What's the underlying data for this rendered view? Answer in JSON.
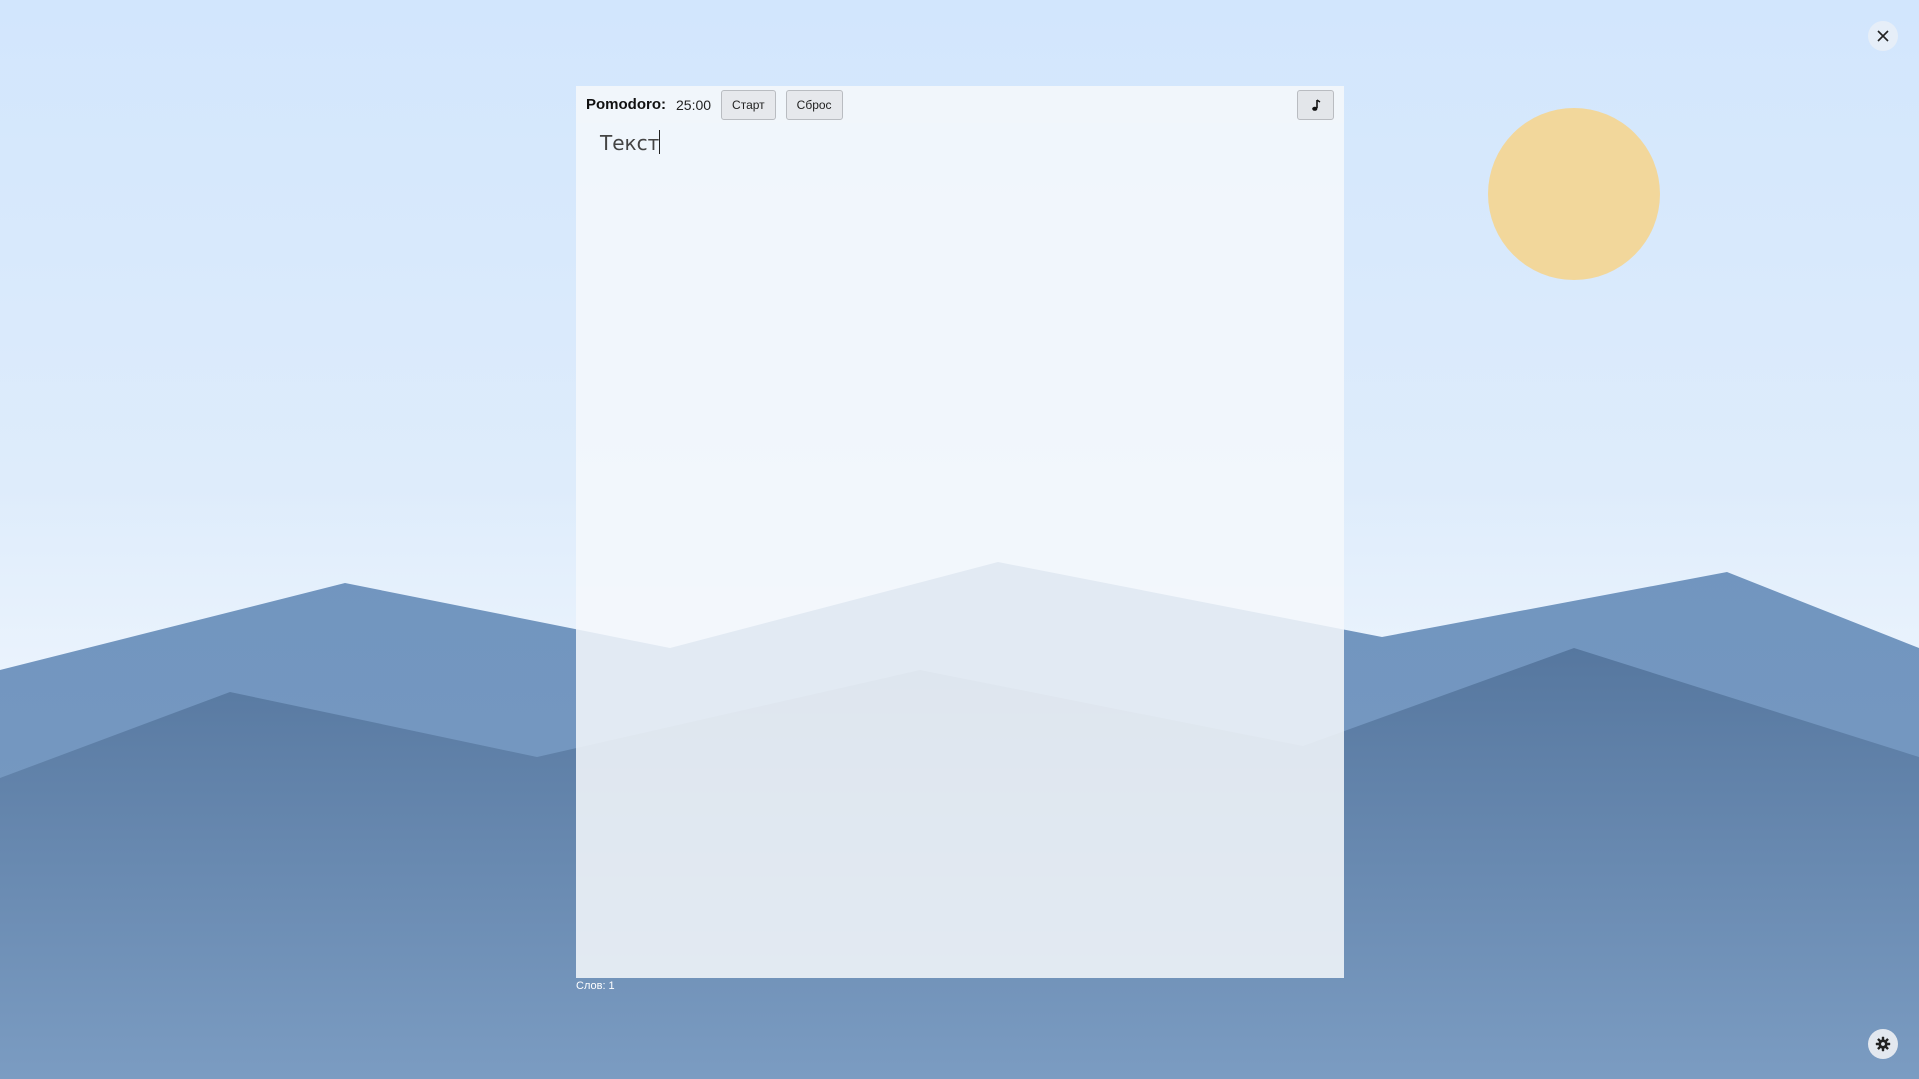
{
  "colors": {
    "sky_top": "#d2e6fd",
    "sun": "#f2d79b",
    "mountain_back": "#7598c0",
    "mountain_front": "#5a7ca3",
    "panel": "#f5f8fc"
  },
  "icons": {
    "close": "close-icon",
    "music": "music-note-icon",
    "settings": "gear-icon"
  },
  "toolbar": {
    "label": "Pomodoro:",
    "timer": "25:00",
    "start_label": "Старт",
    "reset_label": "Сброс"
  },
  "editor": {
    "content": "Текст"
  },
  "status": {
    "word_count": "Слов: 1"
  }
}
